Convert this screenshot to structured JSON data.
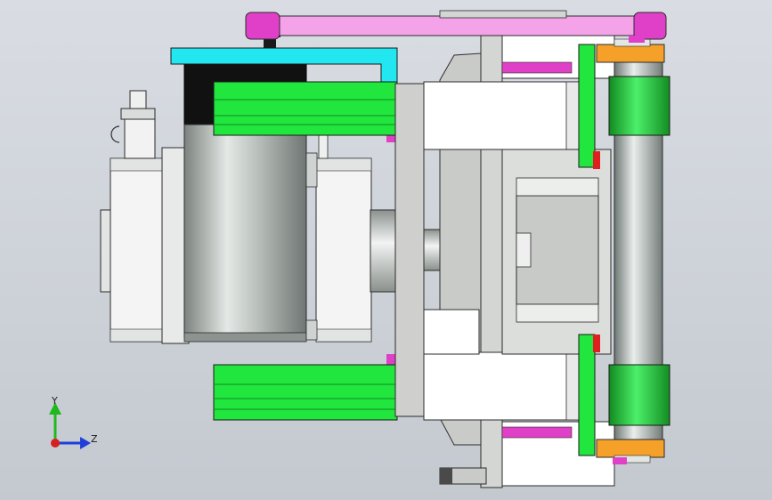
{
  "triad": {
    "y_label": "Y",
    "z_label": "Z"
  },
  "colors": {
    "background_top": "#d9dde3",
    "background_bottom": "#c4c9d0",
    "belt": "#f4a3e8",
    "pulley": "#e040c8",
    "bracket": "#22e6ef",
    "clamp": "#1ee63a",
    "bearing": "#f5a028",
    "roller": "#aeb7b4",
    "motor": "#a9b0ac",
    "housing": "#f0f0f0",
    "plate": "#cfd0cd"
  }
}
